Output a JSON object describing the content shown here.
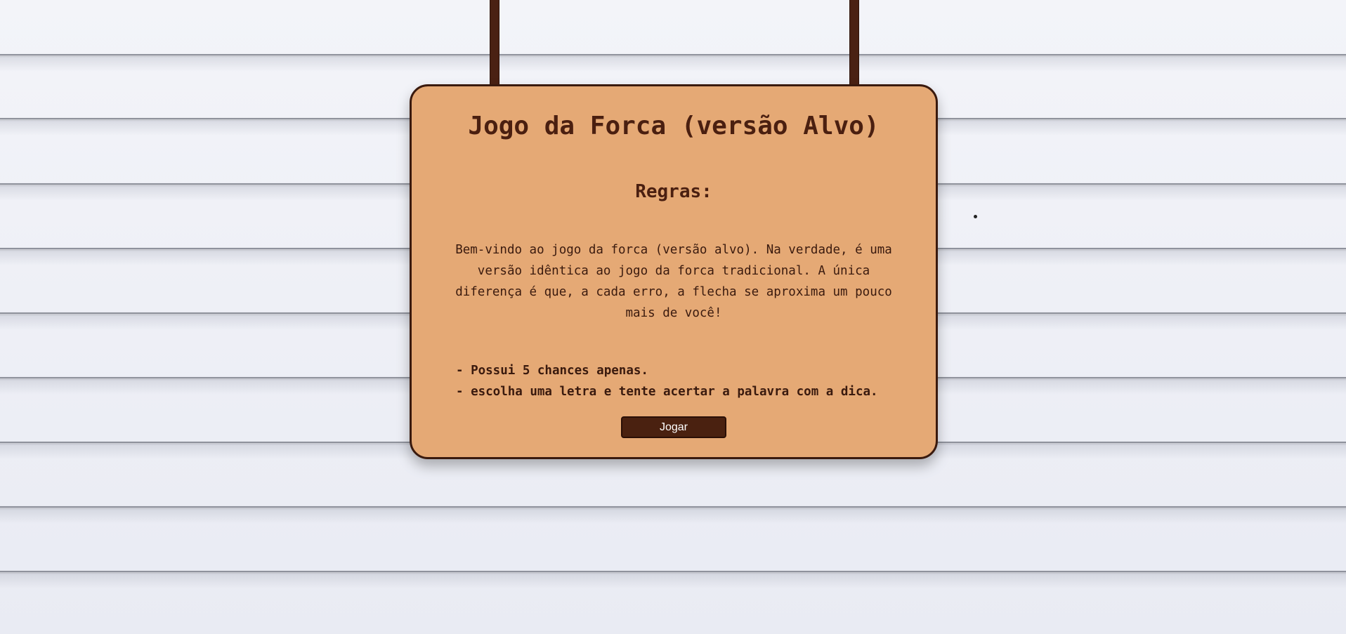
{
  "game": {
    "title": "Jogo da Forca (versão Alvo)",
    "rules_heading": "Regras:",
    "intro": "Bem-vindo ao jogo da forca (versão alvo). Na verdade, é uma versão idêntica ao jogo da forca tradicional. A única diferença é que, a cada erro, a flecha se aproxima um pouco mais de você!",
    "rules": [
      "- Possui 5 chances apenas.",
      "- escolha uma letra e tente acertar a palavra com a dica."
    ],
    "play_label": "Jogar"
  },
  "colors": {
    "sign_background": "#e5a975",
    "sign_border": "#3a1a0e",
    "text": "#4a1f10",
    "button_background": "#4a2110",
    "rope": "#4a2113",
    "wall": "#eef0f6"
  }
}
